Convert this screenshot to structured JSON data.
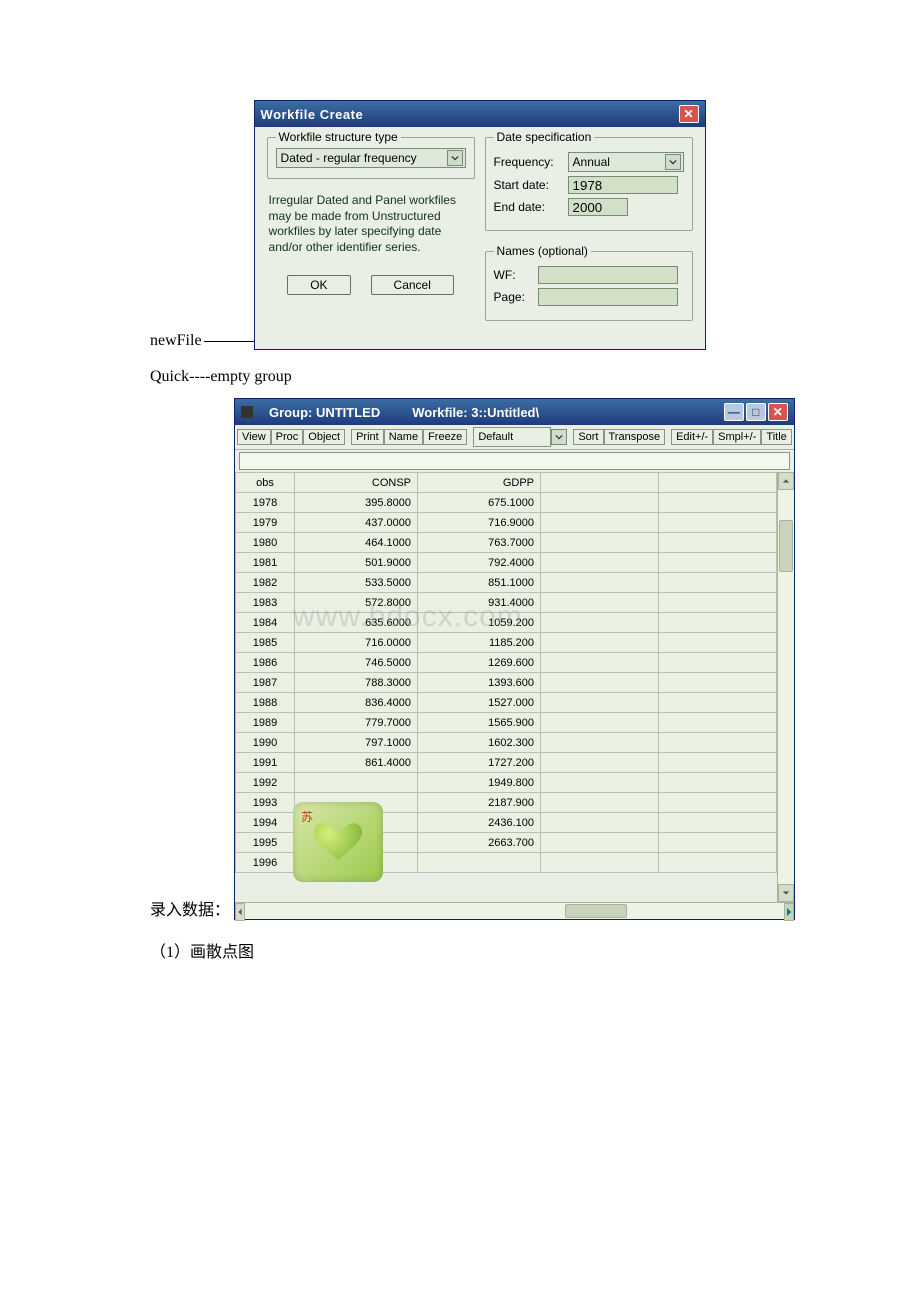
{
  "labels": {
    "newFile": "newFile",
    "quick": "Quick----empty group",
    "enterData": "录入数据：",
    "scatter": "（1）画散点图"
  },
  "dialog": {
    "title": "Workfile Create",
    "structure": {
      "legend": "Workfile structure type",
      "value": "Dated - regular frequency"
    },
    "note": "Irregular Dated and Panel workfiles may be made from Unstructured workfiles by later specifying date and/or other identifier series.",
    "ok": "OK",
    "cancel": "Cancel",
    "date": {
      "legend": "Date specification",
      "freqLabel": "Frequency:",
      "freqValue": "Annual",
      "startLabel": "Start date:",
      "startValue": "1978",
      "endLabel": "End date:",
      "endValue": "2000"
    },
    "names": {
      "legend": "Names (optional)",
      "wfLabel": "WF:",
      "wfValue": "",
      "pageLabel": "Page:",
      "pageValue": ""
    }
  },
  "groupWin": {
    "titleA": "Group: UNTITLED",
    "titleB": "Workfile: 3::Untitled\\",
    "toolbar": [
      "View",
      "Proc",
      "Object",
      "Print",
      "Name",
      "Freeze"
    ],
    "display": "Default",
    "toolbar2": [
      "Sort",
      "Transpose",
      "Edit+/-",
      "Smpl+/-",
      "Title"
    ],
    "headers": {
      "obs": "obs",
      "c1": "CONSP",
      "c2": "GDPP"
    },
    "rows": [
      {
        "obs": "1978",
        "c1": "395.8000",
        "c2": "675.1000"
      },
      {
        "obs": "1979",
        "c1": "437.0000",
        "c2": "716.9000"
      },
      {
        "obs": "1980",
        "c1": "464.1000",
        "c2": "763.7000"
      },
      {
        "obs": "1981",
        "c1": "501.9000",
        "c2": "792.4000"
      },
      {
        "obs": "1982",
        "c1": "533.5000",
        "c2": "851.1000"
      },
      {
        "obs": "1983",
        "c1": "572.8000",
        "c2": "931.4000"
      },
      {
        "obs": "1984",
        "c1": "635.6000",
        "c2": "1059.200"
      },
      {
        "obs": "1985",
        "c1": "716.0000",
        "c2": "1185.200"
      },
      {
        "obs": "1986",
        "c1": "746.5000",
        "c2": "1269.600"
      },
      {
        "obs": "1987",
        "c1": "788.3000",
        "c2": "1393.600"
      },
      {
        "obs": "1988",
        "c1": "836.4000",
        "c2": "1527.000"
      },
      {
        "obs": "1989",
        "c1": "779.7000",
        "c2": "1565.900"
      },
      {
        "obs": "1990",
        "c1": "797.1000",
        "c2": "1602.300"
      },
      {
        "obs": "1991",
        "c1": "861.4000",
        "c2": "1727.200"
      },
      {
        "obs": "1992",
        "c1": "",
        "c2": "1949.800"
      },
      {
        "obs": "1993",
        "c1": "",
        "c2": "2187.900"
      },
      {
        "obs": "1994",
        "c1": "",
        "c2": "2436.100"
      },
      {
        "obs": "1995",
        "c1": "",
        "c2": "2663.700"
      },
      {
        "obs": "1996",
        "c1": "",
        "c2": ""
      }
    ],
    "watermark": "www.bdocx.com",
    "avatarChar": "苏"
  }
}
